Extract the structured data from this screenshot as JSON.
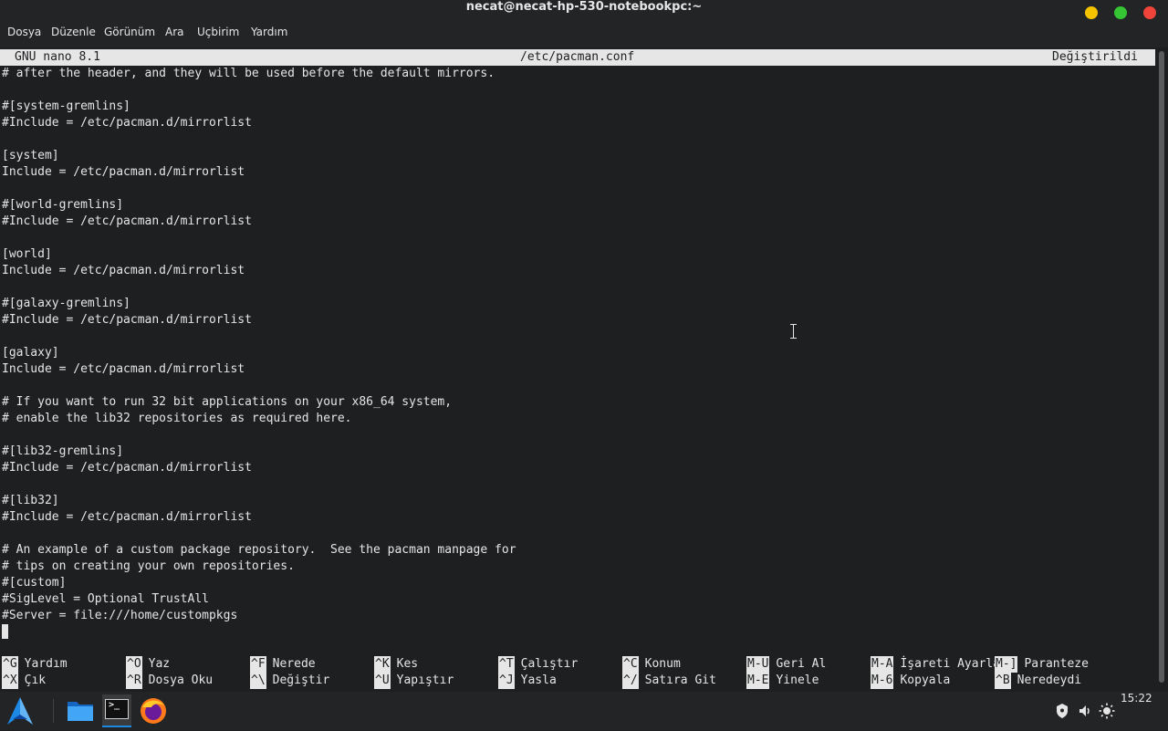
{
  "window": {
    "title": "necat@necat-hp-530-notebookpc:~"
  },
  "menu": [
    {
      "label": "Dosya"
    },
    {
      "label": "Düzenle"
    },
    {
      "label": "Görünüm"
    },
    {
      "label": "Ara"
    },
    {
      "label": "Uçbirim"
    },
    {
      "label": "Yardım"
    }
  ],
  "nano": {
    "version": "GNU nano 8.1",
    "filename": "/etc/pacman.conf",
    "status": "Değiştirildi"
  },
  "lines": [
    "# after the header, and they will be used before the default mirrors.",
    "",
    "#[system-gremlins]",
    "#Include = /etc/pacman.d/mirrorlist",
    "",
    "[system]",
    "Include = /etc/pacman.d/mirrorlist",
    "",
    "#[world-gremlins]",
    "#Include = /etc/pacman.d/mirrorlist",
    "",
    "[world]",
    "Include = /etc/pacman.d/mirrorlist",
    "",
    "#[galaxy-gremlins]",
    "#Include = /etc/pacman.d/mirrorlist",
    "",
    "[galaxy]",
    "Include = /etc/pacman.d/mirrorlist",
    "",
    "# If you want to run 32 bit applications on your x86_64 system,",
    "# enable the lib32 repositories as required here.",
    "",
    "#[lib32-gremlins]",
    "#Include = /etc/pacman.d/mirrorlist",
    "",
    "#[lib32]",
    "#Include = /etc/pacman.d/mirrorlist",
    "",
    "# An example of a custom package repository.  See the pacman manpage for",
    "# tips on creating your own repositories.",
    "#[custom]",
    "#SigLevel = Optional TrustAll",
    "#Server = file:///home/custompkgs",
    ""
  ],
  "shortcuts": {
    "row1": [
      {
        "key": "^G",
        "label": "Yardım"
      },
      {
        "key": "^O",
        "label": "Yaz"
      },
      {
        "key": "^F",
        "label": "Nerede"
      },
      {
        "key": "^K",
        "label": "Kes"
      },
      {
        "key": "^T",
        "label": "Çalıştır"
      },
      {
        "key": "^C",
        "label": "Konum"
      },
      {
        "key": "M-U",
        "label": "Geri Al"
      },
      {
        "key": "M-A",
        "label": "İşareti Ayarla"
      },
      {
        "key": "M-]",
        "label": "Paranteze"
      }
    ],
    "row2": [
      {
        "key": "^X",
        "label": "Çık"
      },
      {
        "key": "^R",
        "label": "Dosya Oku"
      },
      {
        "key": "^\\",
        "label": "Değiştir"
      },
      {
        "key": "^U",
        "label": "Yapıştır"
      },
      {
        "key": "^J",
        "label": "Yasla"
      },
      {
        "key": "^/",
        "label": "Satıra Git"
      },
      {
        "key": "M-E",
        "label": "Yinele"
      },
      {
        "key": "M-6",
        "label": "Kopyala"
      },
      {
        "key": "^B",
        "label": "Neredeydi"
      }
    ]
  },
  "taskbar": {
    "clock": "15:22",
    "icons": [
      "app-menu-icon",
      "file-manager-icon",
      "terminal-icon",
      "firefox-icon",
      "shield-icon",
      "volume-icon",
      "brightness-icon"
    ]
  },
  "colors": {
    "terminal_bg": "#1e1f21",
    "text": "#e6e6e6",
    "panel": "#232426",
    "accent": "#1e88e5"
  }
}
